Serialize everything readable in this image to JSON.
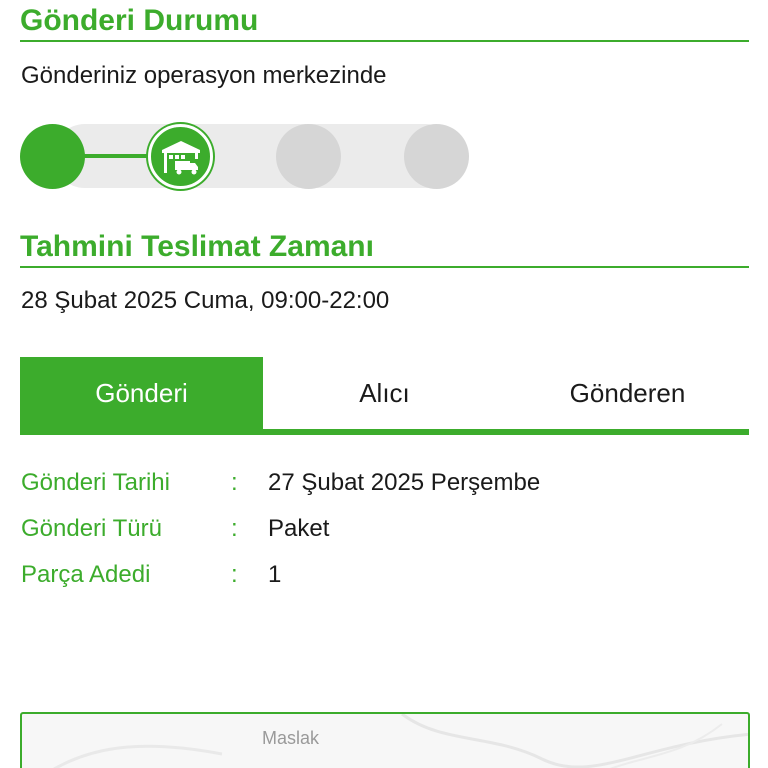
{
  "status": {
    "title": "Gönderi Durumu",
    "text": "Gönderiniz operasyon merkezinde",
    "steps": [
      "done",
      "current",
      "pending",
      "pending"
    ]
  },
  "delivery": {
    "title": "Tahmini Teslimat Zamanı",
    "text": "28 Şubat 2025 Cuma, 09:00-22:00"
  },
  "tabs": [
    {
      "label": "Gönderi",
      "active": true
    },
    {
      "label": "Alıcı",
      "active": false
    },
    {
      "label": "Gönderen",
      "active": false
    }
  ],
  "info": [
    {
      "label": "Gönderi Tarihi",
      "value": "27 Şubat 2025 Perşembe"
    },
    {
      "label": "Gönderi Türü",
      "value": "Paket"
    },
    {
      "label": "Parça Adedi",
      "value": "1"
    }
  ],
  "map": {
    "label": "Maslak"
  },
  "colors": {
    "accent": "#3cac2c",
    "pending": "#d6d6d6"
  }
}
